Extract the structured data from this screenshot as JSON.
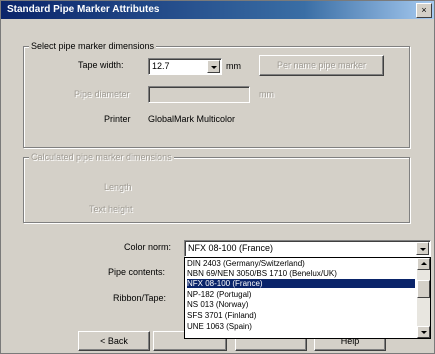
{
  "window": {
    "title": "Standard Pipe Marker Attributes",
    "close_glyph": "×"
  },
  "group1": {
    "legend": "Select pipe marker dimensions",
    "tape_width_label": "Tape width:",
    "tape_width_value": "12.7",
    "tape_width_unit": "mm",
    "pipe_diameter_label": "Pipe diameter",
    "pipe_diameter_unit": "mm",
    "printer_label": "Printer",
    "printer_value": "GlobalMark Multicolor",
    "per_row_button": "Per name pipe marker"
  },
  "group2": {
    "legend": "Calculated pipe marker dimensions",
    "length_label": "Length",
    "text_height_label": "Text height"
  },
  "color_norm": {
    "label": "Color norm:",
    "value": "NFX 08-100 (France)",
    "options": [
      "DIN 2403 (Germany/Switzerland)",
      "NBN 69/NEN 3050/BS 1710 (Benelux/UK)",
      "NFX 08-100 (France)",
      "NP-182 (Portugal)",
      "NS 013 (Norway)",
      "SFS 3701 (Finland)",
      "UNE 1063 (Spain)"
    ],
    "selected_index": 2
  },
  "pipe_contents_label": "Pipe contents:",
  "ribbon_tape_label": "Ribbon/Tape:",
  "buttons": {
    "back": "< Back",
    "next": "",
    "cancel": "",
    "help": "Help"
  }
}
